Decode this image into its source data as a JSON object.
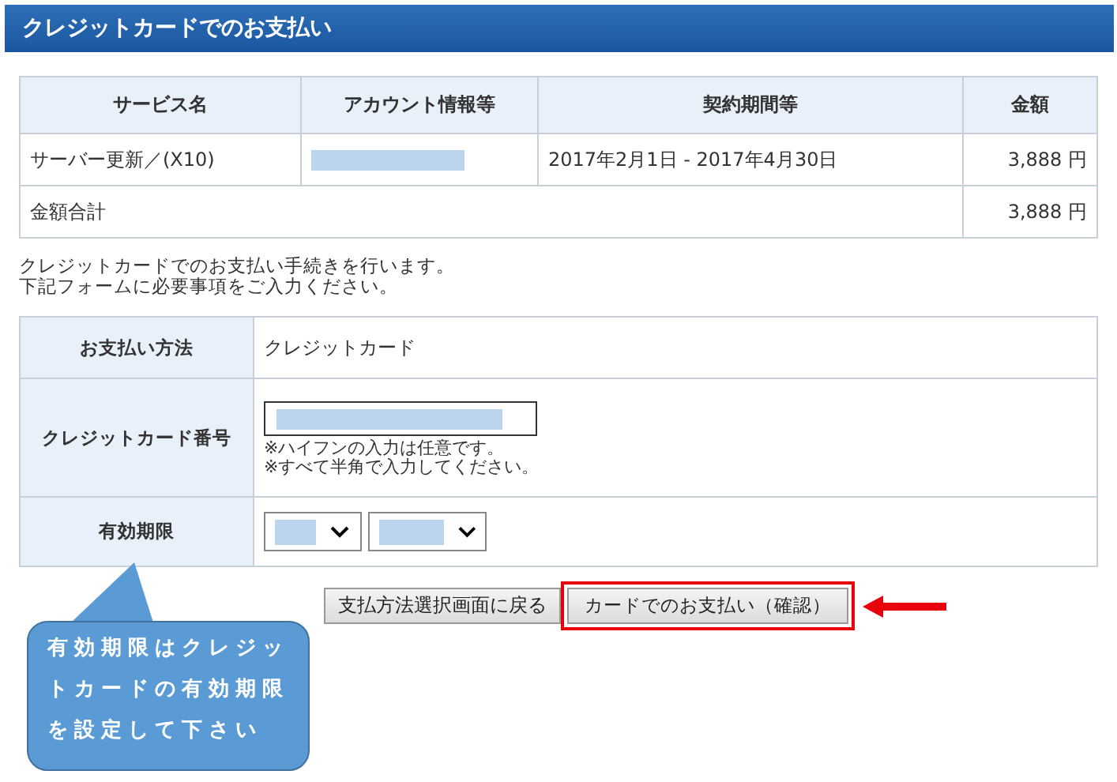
{
  "title": "クレジットカードでのお支払い",
  "services": {
    "columns": [
      "サービス名",
      "アカウント情報等",
      "契約期間等",
      "金額"
    ],
    "rows": [
      {
        "service": "サーバー更新／(X10)",
        "period": "2017年2月1日 - 2017年4月30日",
        "amount": "3,888 円"
      }
    ],
    "total": {
      "label": "金額合計",
      "amount": "3,888 円"
    }
  },
  "intro": [
    "クレジットカードでのお支払い手続きを行います。",
    "下記フォームに必要事項をご入力ください。"
  ],
  "form": {
    "rows": [
      {
        "kind": "text",
        "label": "お支払い方法",
        "value": "クレジットカード"
      },
      {
        "kind": "input",
        "label": "クレジットカード番号",
        "notes": [
          "※ハイフンの入力は任意です。",
          "※すべて半角で入力してください。"
        ]
      },
      {
        "kind": "selects",
        "label": "有効期限"
      }
    ]
  },
  "buttons": [
    {
      "label": "支払方法選択画面に戻る",
      "highlighted": false
    },
    {
      "label": "カードでのお支払い（確認）",
      "highlighted": true
    }
  ],
  "callout": "有効期限はクレジットカードの有効期限を設定して下さい"
}
